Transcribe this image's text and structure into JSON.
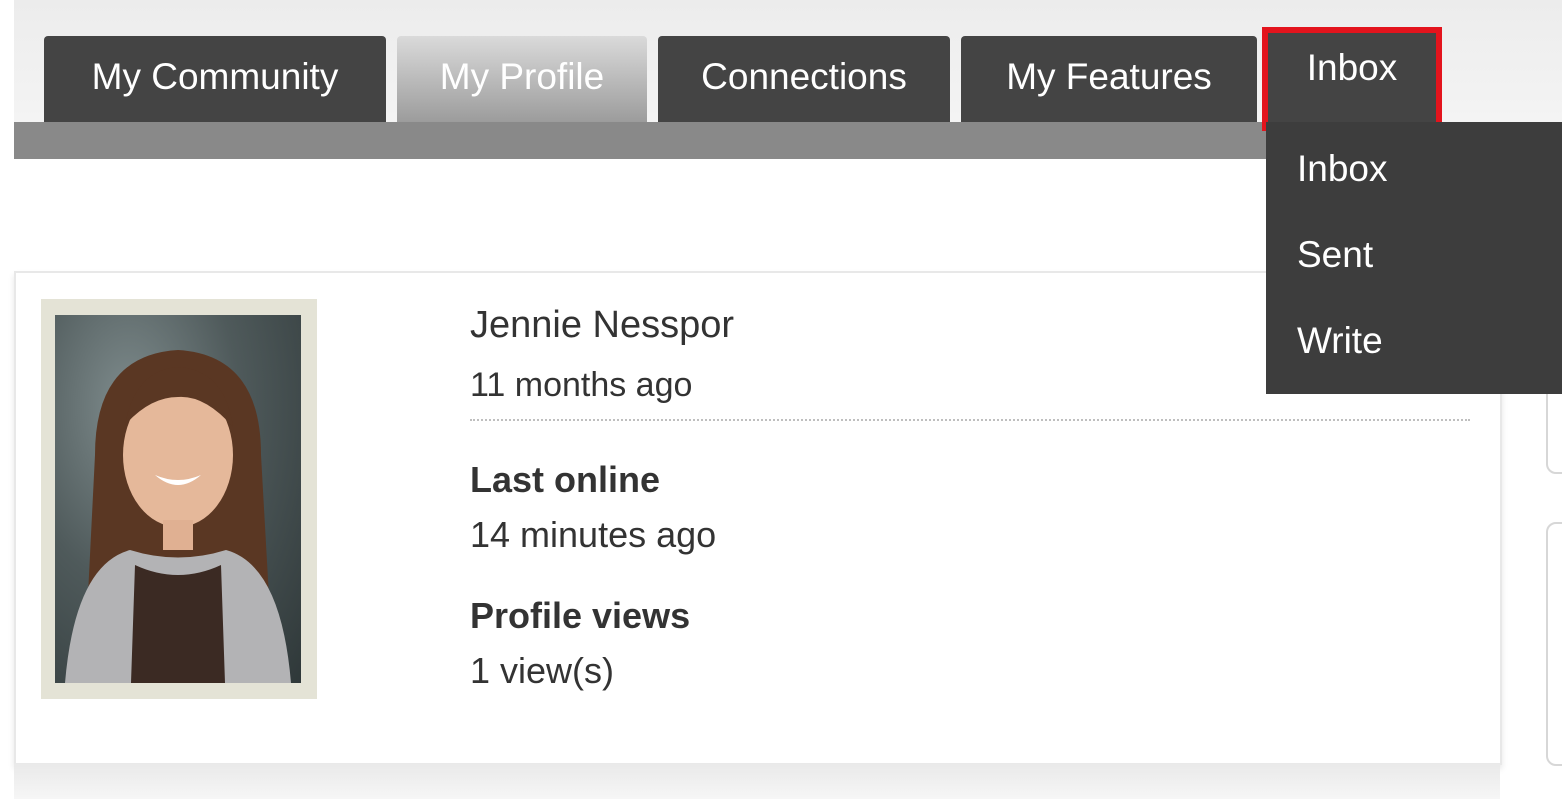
{
  "nav": {
    "tabs": [
      {
        "label": "My Community"
      },
      {
        "label": "My Profile"
      },
      {
        "label": "Connections"
      },
      {
        "label": "My Features"
      },
      {
        "label": "Inbox"
      }
    ],
    "active_tab": "My Profile",
    "highlighted_tab": "Inbox",
    "highlight_color": "#e3141d"
  },
  "inbox_menu": {
    "items": [
      {
        "label": "Inbox"
      },
      {
        "label": "Sent"
      },
      {
        "label": "Write"
      }
    ]
  },
  "profile": {
    "name": "Jennie Nesspor",
    "joined": "11 months ago",
    "last_online_label": "Last online",
    "last_online_value": "14 minutes ago",
    "profile_views_label": "Profile views",
    "profile_views_value": "1 view(s)"
  },
  "colors": {
    "tab_bg": "#444444",
    "nav_bar": "#898989",
    "dropdown_bg": "#3d3d3d",
    "avatar_frame": "#e4e3d6"
  }
}
